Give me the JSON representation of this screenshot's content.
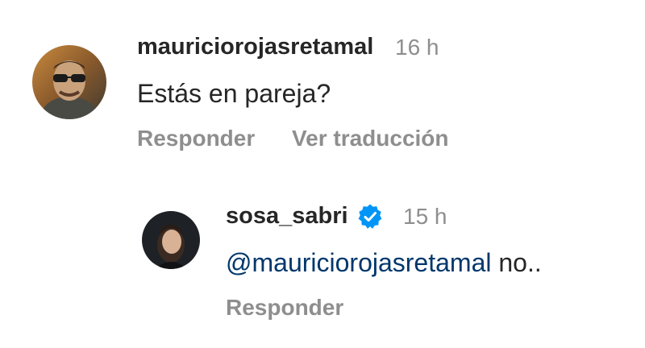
{
  "comment": {
    "username": "mauriciorojasretamal",
    "time": "16 h",
    "text": "Estás en pareja?",
    "reply_label": "Responder",
    "translate_label": "Ver traducción"
  },
  "reply": {
    "username": "sosa_sabri",
    "verified": true,
    "time": "15 h",
    "mention": "@mauriciorojasretamal",
    "text": " no..",
    "reply_label": "Responder"
  },
  "colors": {
    "username": "#262626",
    "muted": "#8e8e8e",
    "mention": "#00376b",
    "verified": "#0095f6"
  },
  "icons": [
    "verified-badge-icon"
  ]
}
